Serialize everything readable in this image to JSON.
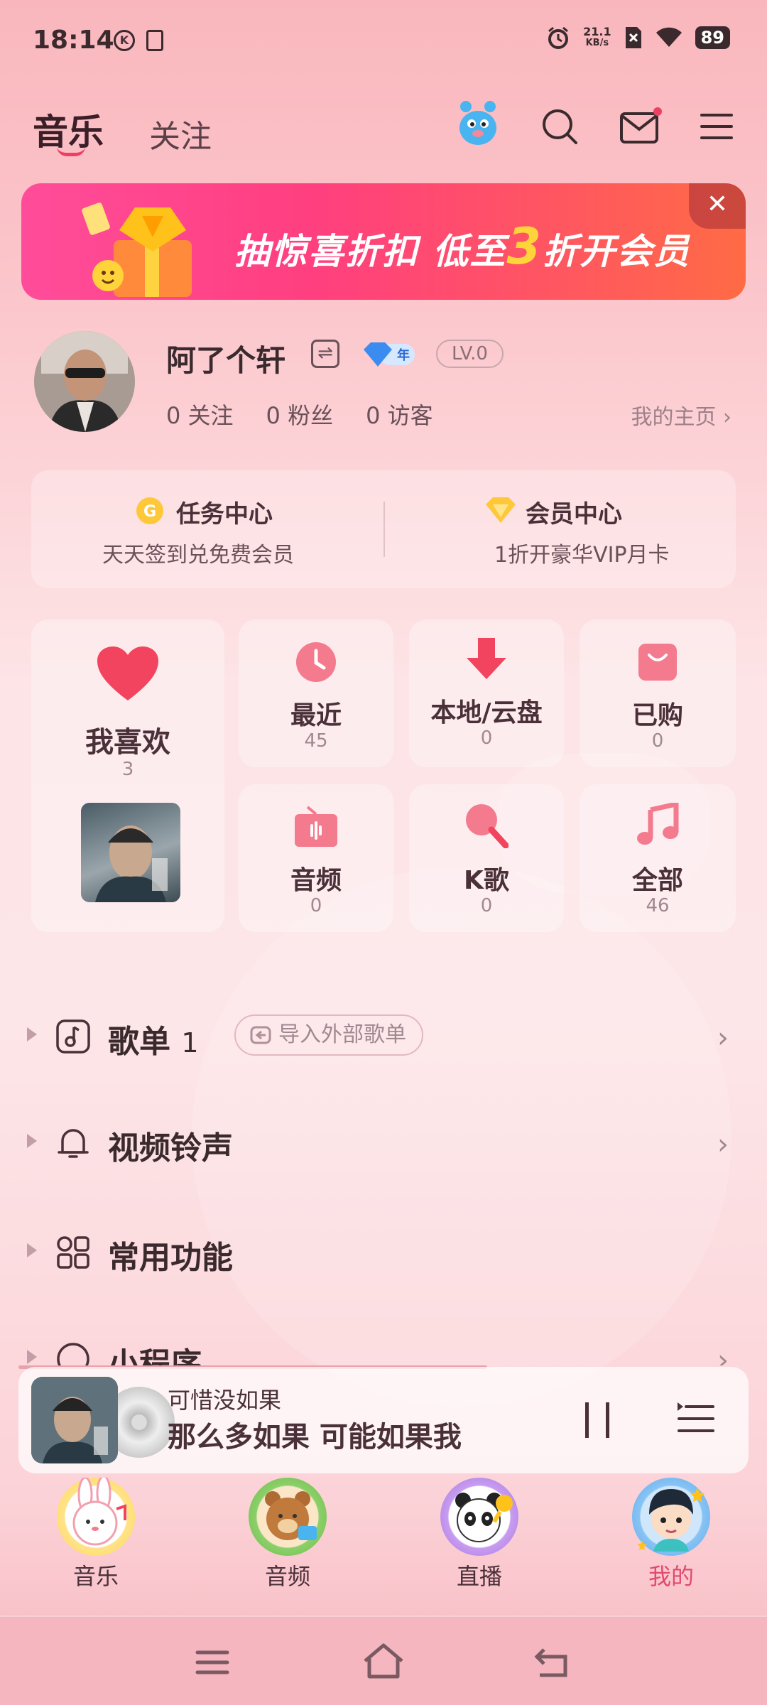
{
  "status_bar": {
    "time": "18:14",
    "speed": "21.1",
    "speed_unit": "KB/s",
    "battery": "89"
  },
  "header": {
    "tab_music": "音乐",
    "tab_follow": "关注"
  },
  "banner": {
    "text_pre": "抽惊喜折扣 低至",
    "text_num": "3",
    "text_post": "折开会员",
    "close": "✕"
  },
  "profile": {
    "name": "阿了个轩",
    "vip_tag": "年",
    "level": "LV.0",
    "following": "0 关注",
    "fans": "0 粉丝",
    "visitors": "0 访客",
    "homepage": "我的主页 ›"
  },
  "centers": [
    {
      "title": "任务中心",
      "sub": "天天签到兑免费会员"
    },
    {
      "title": "会员中心",
      "sub": "1折开豪华VIP月卡"
    }
  ],
  "tiles": {
    "favorites": {
      "label": "我喜欢",
      "count": "3"
    },
    "recent": {
      "label": "最近",
      "count": "45"
    },
    "local": {
      "label": "本地/云盘",
      "count": "0"
    },
    "purchased": {
      "label": "已购",
      "count": "0"
    },
    "audio": {
      "label": "音频",
      "count": "0"
    },
    "karaoke": {
      "label": "K歌",
      "count": "0"
    },
    "all": {
      "label": "全部",
      "count": "46"
    }
  },
  "rows": {
    "playlist": {
      "label": "歌单",
      "count": "1",
      "import": "导入外部歌单"
    },
    "ringtone": {
      "label": "视频铃声"
    },
    "common": {
      "label": "常用功能"
    },
    "miniprogram": {
      "label": "小程序"
    }
  },
  "player": {
    "title": "可惜没如果",
    "lyric": "那么多如果 可能如果我"
  },
  "bottom_nav": [
    {
      "label": "音乐"
    },
    {
      "label": "音频"
    },
    {
      "label": "直播"
    },
    {
      "label": "我的"
    }
  ],
  "colors": {
    "accent": "#ef3e63",
    "active_tab": "#e2496e"
  }
}
